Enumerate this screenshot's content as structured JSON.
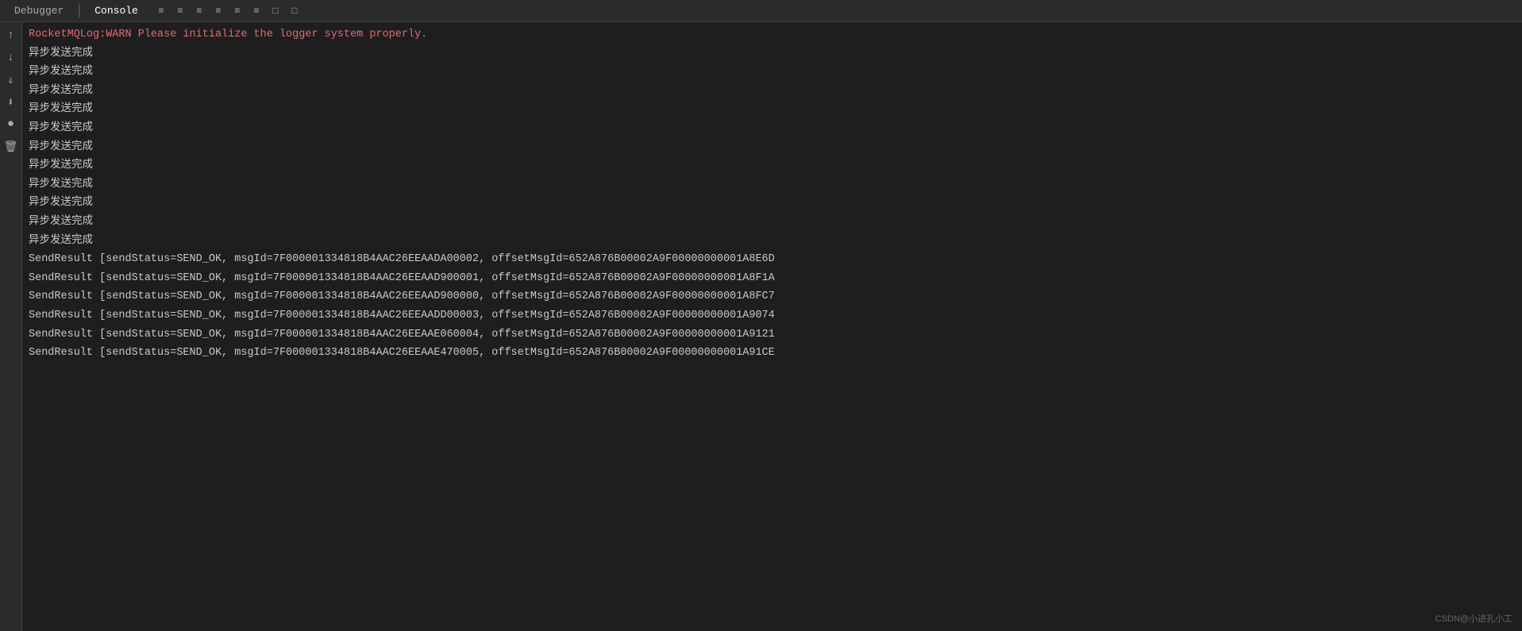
{
  "topbar": {
    "tabs": [
      {
        "label": "Debugger",
        "active": false
      },
      {
        "label": "Console",
        "active": true
      }
    ],
    "toolbar_icons": [
      "≡",
      "≡",
      "≡",
      "≡",
      "≡",
      "≡",
      "□",
      "□"
    ]
  },
  "sidebar": {
    "icons": [
      "↑",
      "↓",
      "⇓",
      "⬇",
      "⏺",
      "🗑"
    ]
  },
  "console": {
    "warn_line": "RocketMQLog:WARN Please initialize the logger system properly.",
    "normal_lines": [
      "异步发送完成",
      "异步发送完成",
      "异步发送完成",
      "异步发送完成",
      "异步发送完成",
      "异步发送完成",
      "异步发送完成",
      "异步发送完成",
      "异步发送完成",
      "异步发送完成",
      "异步发送完成"
    ],
    "send_results": [
      "SendResult [sendStatus=SEND_OK, msgId=7F000001334818B4AAC26EEAADA00002, offsetMsgId=652A876B00002A9F00000000001A8E6D",
      "SendResult [sendStatus=SEND_OK, msgId=7F000001334818B4AAC26EEAAD900001, offsetMsgId=652A876B00002A9F00000000001A8F1A",
      "SendResult [sendStatus=SEND_OK, msgId=7F000001334818B4AAC26EEAAD900000, offsetMsgId=652A876B00002A9F00000000001A8FC7",
      "SendResult [sendStatus=SEND_OK, msgId=7F000001334818B4AAC26EEAADD00003, offsetMsgId=652A876B00002A9F00000000001A9074",
      "SendResult [sendStatus=SEND_OK, msgId=7F000001334818B4AAC26EEAAE060004, offsetMsgId=652A876B00002A9F00000000001A9121",
      "SendResult [sendStatus=SEND_OK, msgId=7F000001334818B4AAC26EEAAE470005, offsetMsgId=652A876B00002A9F00000000001A91CE"
    ]
  },
  "watermark": {
    "text": "CSDN@小进孔小工"
  }
}
